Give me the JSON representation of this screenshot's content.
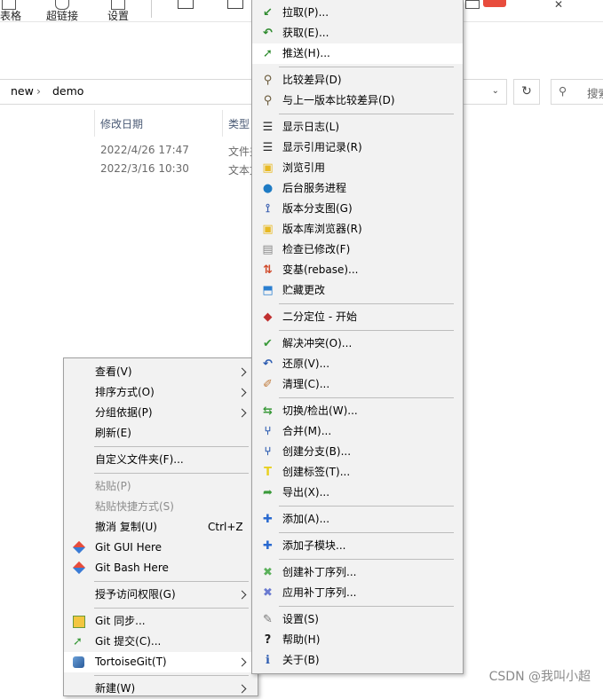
{
  "ribbon": {
    "items": [
      {
        "name": "table",
        "label": "表格"
      },
      {
        "name": "hyperlink",
        "label": "超链接"
      },
      {
        "name": "setting",
        "label": "设置"
      }
    ]
  },
  "address": {
    "segment1": "new",
    "sep": "›",
    "segment2": "demo",
    "dropdown_glyph": "⌄",
    "refresh_glyph": "↻",
    "search_placeholder": "搜索"
  },
  "files": {
    "columns": [
      "修改日期",
      "类型"
    ],
    "rows": [
      {
        "date": "2022/4/26 17:47",
        "type": "文件夹"
      },
      {
        "date": "2022/3/16 10:30",
        "type": "文本文"
      }
    ]
  },
  "context_menu": {
    "items": [
      {
        "label": "查看(V)",
        "submenu": true
      },
      {
        "label": "排序方式(O)",
        "submenu": true
      },
      {
        "label": "分组依据(P)",
        "submenu": true
      },
      {
        "label": "刷新(E)"
      },
      {
        "sep": true
      },
      {
        "label": "自定义文件夹(F)..."
      },
      {
        "sep": true
      },
      {
        "label": "粘贴(P)",
        "disabled": true
      },
      {
        "label": "粘贴快捷方式(S)",
        "disabled": true
      },
      {
        "label": "撤消 复制(U)",
        "shortcut": "Ctrl+Z"
      },
      {
        "label": "Git GUI Here",
        "icon": "git-diamond-icon"
      },
      {
        "label": "Git Bash Here",
        "icon": "git-diamond-icon"
      },
      {
        "sep": true
      },
      {
        "label": "授予访问权限(G)",
        "submenu": true
      },
      {
        "sep": true
      },
      {
        "label": "Git 同步...",
        "icon": "git-sync-icon"
      },
      {
        "label": "Git 提交(C)...",
        "icon": "git-commit-icon"
      },
      {
        "label": "TortoiseGit(T)",
        "submenu": true,
        "highlight": true,
        "icon": "tortoisegit-icon"
      },
      {
        "sep": true
      },
      {
        "label": "新建(W)",
        "submenu": true
      }
    ]
  },
  "tortoise_menu": {
    "items": [
      {
        "label": "拉取(P)...",
        "icon": "pull-icon",
        "color": "#2d8a2d"
      },
      {
        "label": "获取(E)...",
        "icon": "fetch-icon",
        "color": "#2d8a2d"
      },
      {
        "label": "推送(H)...",
        "icon": "push-icon",
        "color": "#2d8a2d",
        "highlight": true
      },
      {
        "sep": true
      },
      {
        "label": "比较差异(D)",
        "icon": "diff-magnifier-icon",
        "color": "#6a5a3a"
      },
      {
        "label": "与上一版本比较差异(D)",
        "icon": "diff-prev-magnifier-icon",
        "color": "#6a5a3a"
      },
      {
        "sep": true
      },
      {
        "label": "显示日志(L)",
        "icon": "log-icon",
        "color": "#222222"
      },
      {
        "label": "显示引用记录(R)",
        "icon": "reflog-icon",
        "color": "#222222"
      },
      {
        "label": "浏览引用",
        "icon": "browse-refs-icon",
        "color": "#e8b923"
      },
      {
        "label": "后台服务进程",
        "icon": "daemon-globe-icon",
        "color": "#1e7bc4"
      },
      {
        "label": "版本分支图(G)",
        "icon": "revision-graph-icon",
        "color": "#3a5fb0"
      },
      {
        "label": "版本库浏览器(R)",
        "icon": "repo-browser-icon",
        "color": "#e8b923"
      },
      {
        "label": "检查已修改(F)",
        "icon": "check-modifications-icon",
        "color": "#8a8a8a"
      },
      {
        "label": "变基(rebase)...",
        "icon": "rebase-icon",
        "color": "#d04a2a"
      },
      {
        "label": "贮藏更改",
        "icon": "stash-icon",
        "color": "#2a7fd0"
      },
      {
        "sep": true
      },
      {
        "label": "二分定位 - 开始",
        "icon": "bisect-icon",
        "color": "#c03030"
      },
      {
        "sep": true
      },
      {
        "label": "解决冲突(O)...",
        "icon": "resolve-icon",
        "color": "#3a9a3a"
      },
      {
        "label": "还原(V)...",
        "icon": "revert-icon",
        "color": "#2a5ab0"
      },
      {
        "label": "清理(C)...",
        "icon": "cleanup-broom-icon",
        "color": "#c07a3a"
      },
      {
        "sep": true
      },
      {
        "label": "切换/检出(W)...",
        "icon": "switch-checkout-icon",
        "color": "#3a9a3a"
      },
      {
        "label": "合并(M)...",
        "icon": "merge-icon",
        "color": "#2a5ab0"
      },
      {
        "label": "创建分支(B)...",
        "icon": "branch-icon",
        "color": "#2a5ab0"
      },
      {
        "label": "创建标签(T)...",
        "icon": "tag-icon",
        "color": "#e8d020"
      },
      {
        "label": "导出(X)...",
        "icon": "export-icon",
        "color": "#3a9a3a"
      },
      {
        "sep": true
      },
      {
        "label": "添加(A)...",
        "icon": "add-plus-icon",
        "color": "#2a6ad0"
      },
      {
        "sep": true
      },
      {
        "label": "添加子模块...",
        "icon": "add-submodule-plus-icon",
        "color": "#2a6ad0"
      },
      {
        "sep": true
      },
      {
        "label": "创建补丁序列...",
        "icon": "create-patch-icon",
        "color": "#5ab05a"
      },
      {
        "label": "应用补丁序列...",
        "icon": "apply-patch-icon",
        "color": "#6a7ad0"
      },
      {
        "sep": true
      },
      {
        "label": "设置(S)",
        "icon": "settings-wrench-icon",
        "color": "#777777"
      },
      {
        "label": "帮助(H)",
        "icon": "help-icon",
        "color": "#222222"
      },
      {
        "label": "关于(B)",
        "icon": "about-info-icon",
        "color": "#2a5ab0"
      }
    ]
  },
  "watermark": "CSDN @我叫小超"
}
